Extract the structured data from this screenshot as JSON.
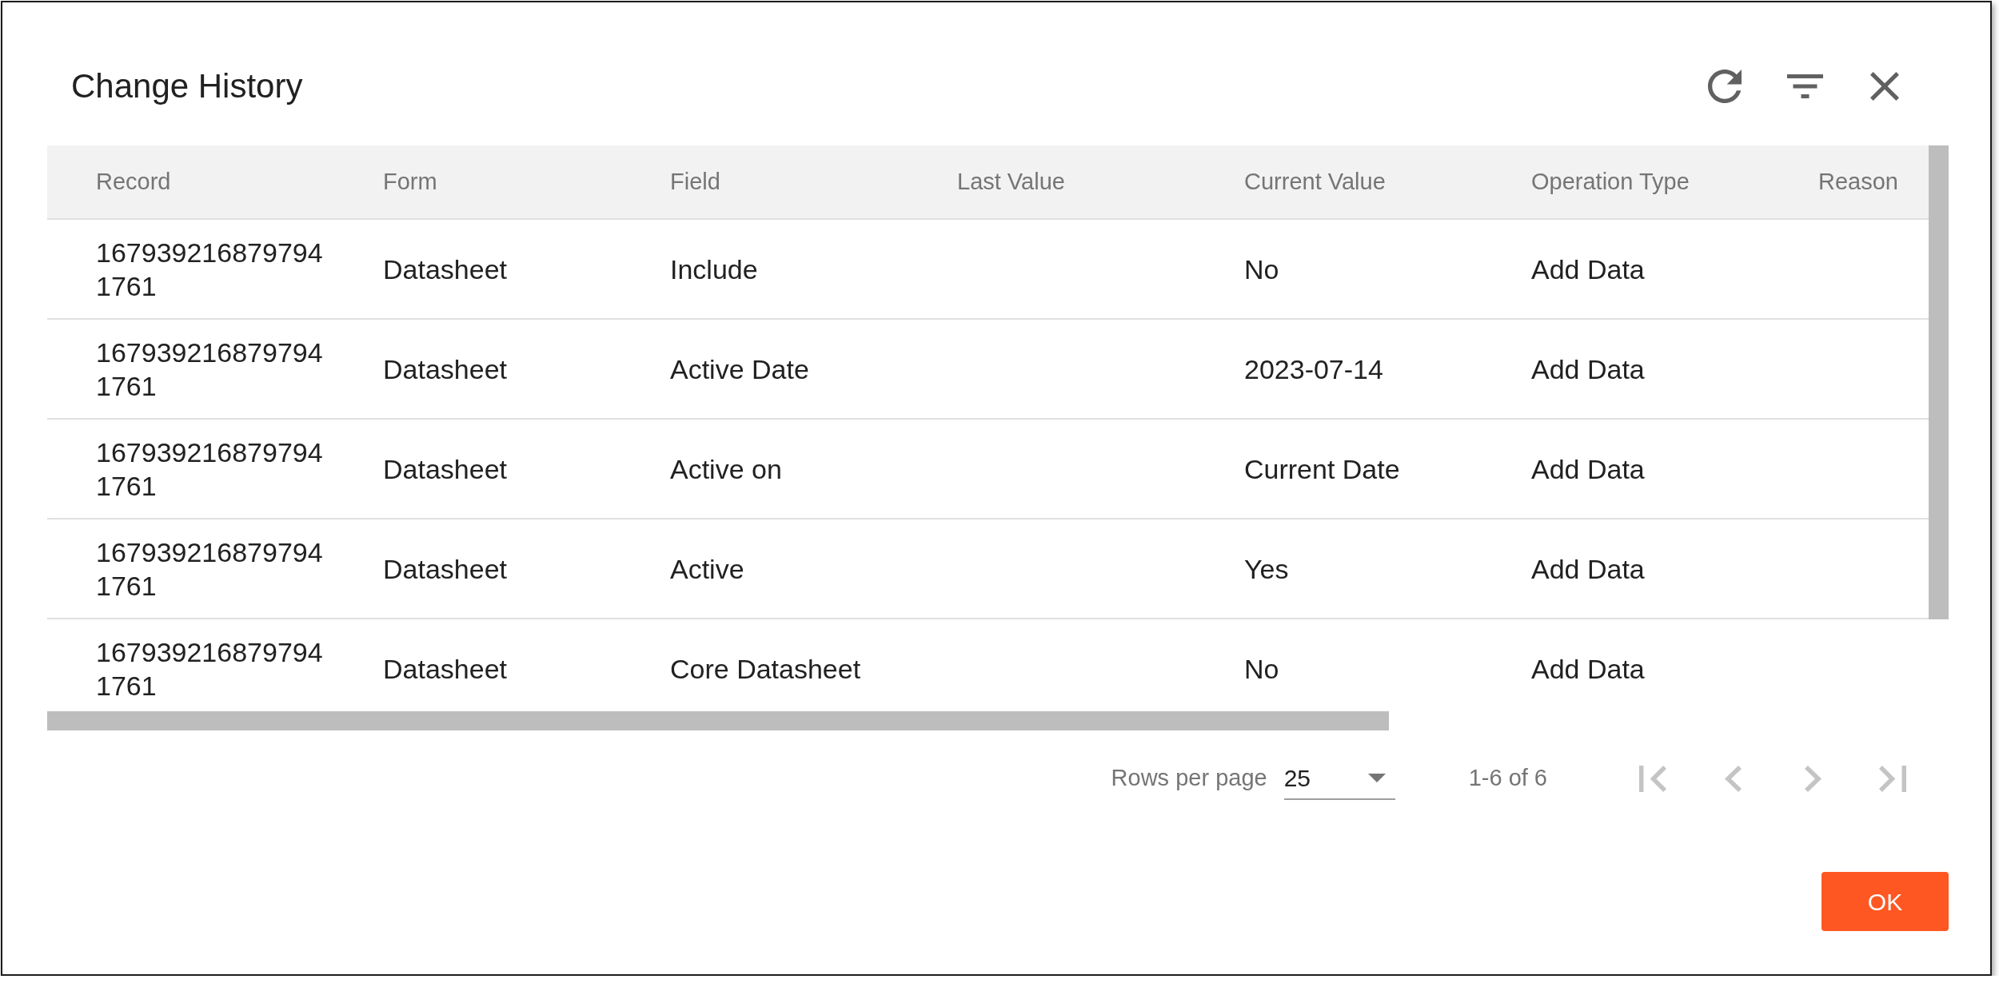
{
  "dialog": {
    "title": "Change History"
  },
  "table": {
    "columns": [
      "Record",
      "Form",
      "Field",
      "Last Value",
      "Current Value",
      "Operation Type",
      "Reason"
    ],
    "rows": [
      {
        "record": "1679392168797941761",
        "form": "Datasheet",
        "field": "Include",
        "current_value": "No",
        "operation_type": "Add Data"
      },
      {
        "record": "1679392168797941761",
        "form": "Datasheet",
        "field": "Active Date",
        "current_value": "2023-07-14",
        "operation_type": "Add Data"
      },
      {
        "record": "1679392168797941761",
        "form": "Datasheet",
        "field": "Active on",
        "current_value": "Current Date",
        "operation_type": "Add Data"
      },
      {
        "record": "1679392168797941761",
        "form": "Datasheet",
        "field": "Active",
        "current_value": "Yes",
        "operation_type": "Add Data"
      },
      {
        "record": "1679392168797941761",
        "form": "Datasheet",
        "field": "Core Datasheet",
        "current_value": "No",
        "operation_type": "Add Data"
      }
    ]
  },
  "pagination": {
    "rows_per_page_label": "Rows per page",
    "rows_per_page": "25",
    "range": "1-6 of 6",
    "buttons": [
      {
        "kind": "first",
        "disabled": true
      },
      {
        "kind": "previous",
        "disabled": true
      },
      {
        "kind": "next",
        "disabled": true
      },
      {
        "kind": "last",
        "disabled": true
      }
    ]
  },
  "footer": {
    "ok_button": "OK"
  }
}
